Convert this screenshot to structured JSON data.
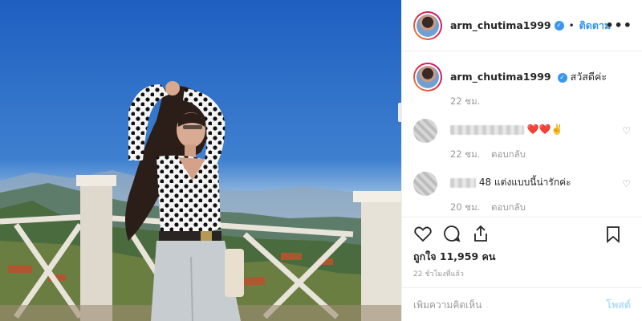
{
  "post": {
    "username": "arm_chutima1999",
    "follow_label": "ติดตาม",
    "more_label": "•••",
    "caption": "สวัสดีค่ะ",
    "caption_time": "22 ชม.",
    "likes_label": "ถูกใจ 11,959 คน",
    "posted_ago": "22 ชั่วโมงที่แล้ว",
    "add_comment_placeholder": "เพิ่มความคิดเห็น",
    "post_button": "โพสต์"
  },
  "comments": [
    {
      "text": "❤️❤️✌️",
      "time": "22 ชม.",
      "reply": "ตอบกลับ"
    },
    {
      "text": "48 แต่งแบบนี้น่ารักค่ะ",
      "time": "20 ชม.",
      "reply": "ตอบกลับ"
    }
  ],
  "icons": {
    "verified": "verified-badge-icon",
    "like": "heart-outline-icon",
    "comment": "comment-bubble-icon",
    "share": "share-icon",
    "save": "bookmark-icon"
  },
  "colors": {
    "accent": "#3897f0",
    "sky": "#2f6ec4"
  }
}
